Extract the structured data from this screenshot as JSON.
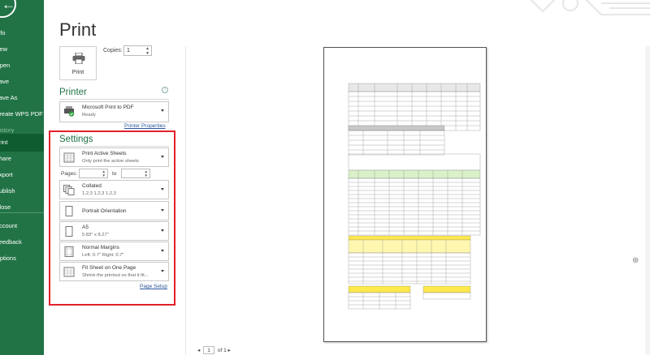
{
  "nav": {
    "items": [
      {
        "label": "Info",
        "active": false,
        "disabled": false
      },
      {
        "label": "New",
        "active": false,
        "disabled": false
      },
      {
        "label": "Open",
        "active": false,
        "disabled": false
      },
      {
        "label": "Save",
        "active": false,
        "disabled": false
      },
      {
        "label": "Save As",
        "active": false,
        "disabled": false
      },
      {
        "label": "Create WPS PDF",
        "active": false,
        "disabled": false
      },
      {
        "label": "History",
        "active": false,
        "disabled": true
      },
      {
        "label": "Print",
        "active": true,
        "disabled": false
      },
      {
        "label": "Share",
        "active": false,
        "disabled": false
      },
      {
        "label": "Export",
        "active": false,
        "disabled": false
      },
      {
        "label": "Publish",
        "active": false,
        "disabled": false
      },
      {
        "label": "Close",
        "active": false,
        "disabled": false
      },
      {
        "label": "Account",
        "active": false,
        "disabled": false
      },
      {
        "label": "Feedback",
        "active": false,
        "disabled": false
      },
      {
        "label": "Options",
        "active": false,
        "disabled": false
      }
    ]
  },
  "page_title": "Print",
  "print_button": "Print",
  "copies": {
    "label": "Copies:",
    "value": "1"
  },
  "printer": {
    "title": "Printer",
    "name": "Microsoft Print to PDF",
    "status": "Ready",
    "properties_link": "Printer Properties"
  },
  "settings": {
    "title": "Settings",
    "what": {
      "main": "Print Active Sheets",
      "sub": "Only print the active sheets"
    },
    "pages_label": "Pages:",
    "to_label": "to",
    "collate": {
      "main": "Collated",
      "sub": "1,2,3    1,2,3    1,2,3"
    },
    "orientation": {
      "main": "Portrait Orientation"
    },
    "paper": {
      "main": "A5",
      "sub": "5.83\" x 8.27\""
    },
    "margins": {
      "main": "Normal Margins",
      "sub": "Left:  0.7\"    Right:  0.7\""
    },
    "scaling": {
      "main": "Fit Sheet on One Page",
      "sub": "Shrink the printout so that it fit..."
    },
    "page_setup_link": "Page Setup"
  },
  "pager": {
    "current": "1",
    "of_label": "of 1"
  },
  "colors": {
    "accent": "#217346",
    "highlight_border": "#e2202a",
    "link": "#2b579a"
  }
}
